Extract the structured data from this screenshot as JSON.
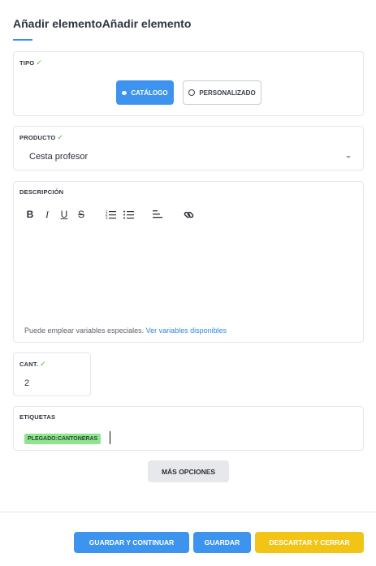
{
  "header": {
    "title": "Añadir elementoAñadir elemento"
  },
  "tipo": {
    "label": "TIPO",
    "check": "✓",
    "options": [
      {
        "label": "CATÁLOGO",
        "selected": true
      },
      {
        "label": "PERSONALIZADO",
        "selected": false
      }
    ]
  },
  "producto": {
    "label": "PRODUCTO",
    "check": "✓",
    "value": "Cesta profesor"
  },
  "descripcion": {
    "label": "DESCRIPCIÓN",
    "toolbar": {
      "bold": "B",
      "italic": "I",
      "underline": "U",
      "strike": "S"
    },
    "hint_text": "Puede emplear variables especiales. ",
    "hint_link": "Ver variables disponibles"
  },
  "cantidad": {
    "label": "CANT.",
    "check": "✓",
    "value": "2"
  },
  "etiquetas": {
    "label": "ETIQUETAS",
    "tags": [
      "PLEGADO:CANTONERAS"
    ]
  },
  "more_options": "MÁS OPCIONES",
  "footer": {
    "save_continue": "GUARDAR Y CONTINUAR",
    "save": "GUARDAR",
    "discard_close": "DESCARTAR Y CERRAR"
  },
  "colors": {
    "primary": "#3d94ee",
    "warning": "#f2c416",
    "success_check": "#52b43a",
    "tag_bg": "#8fe48f"
  }
}
